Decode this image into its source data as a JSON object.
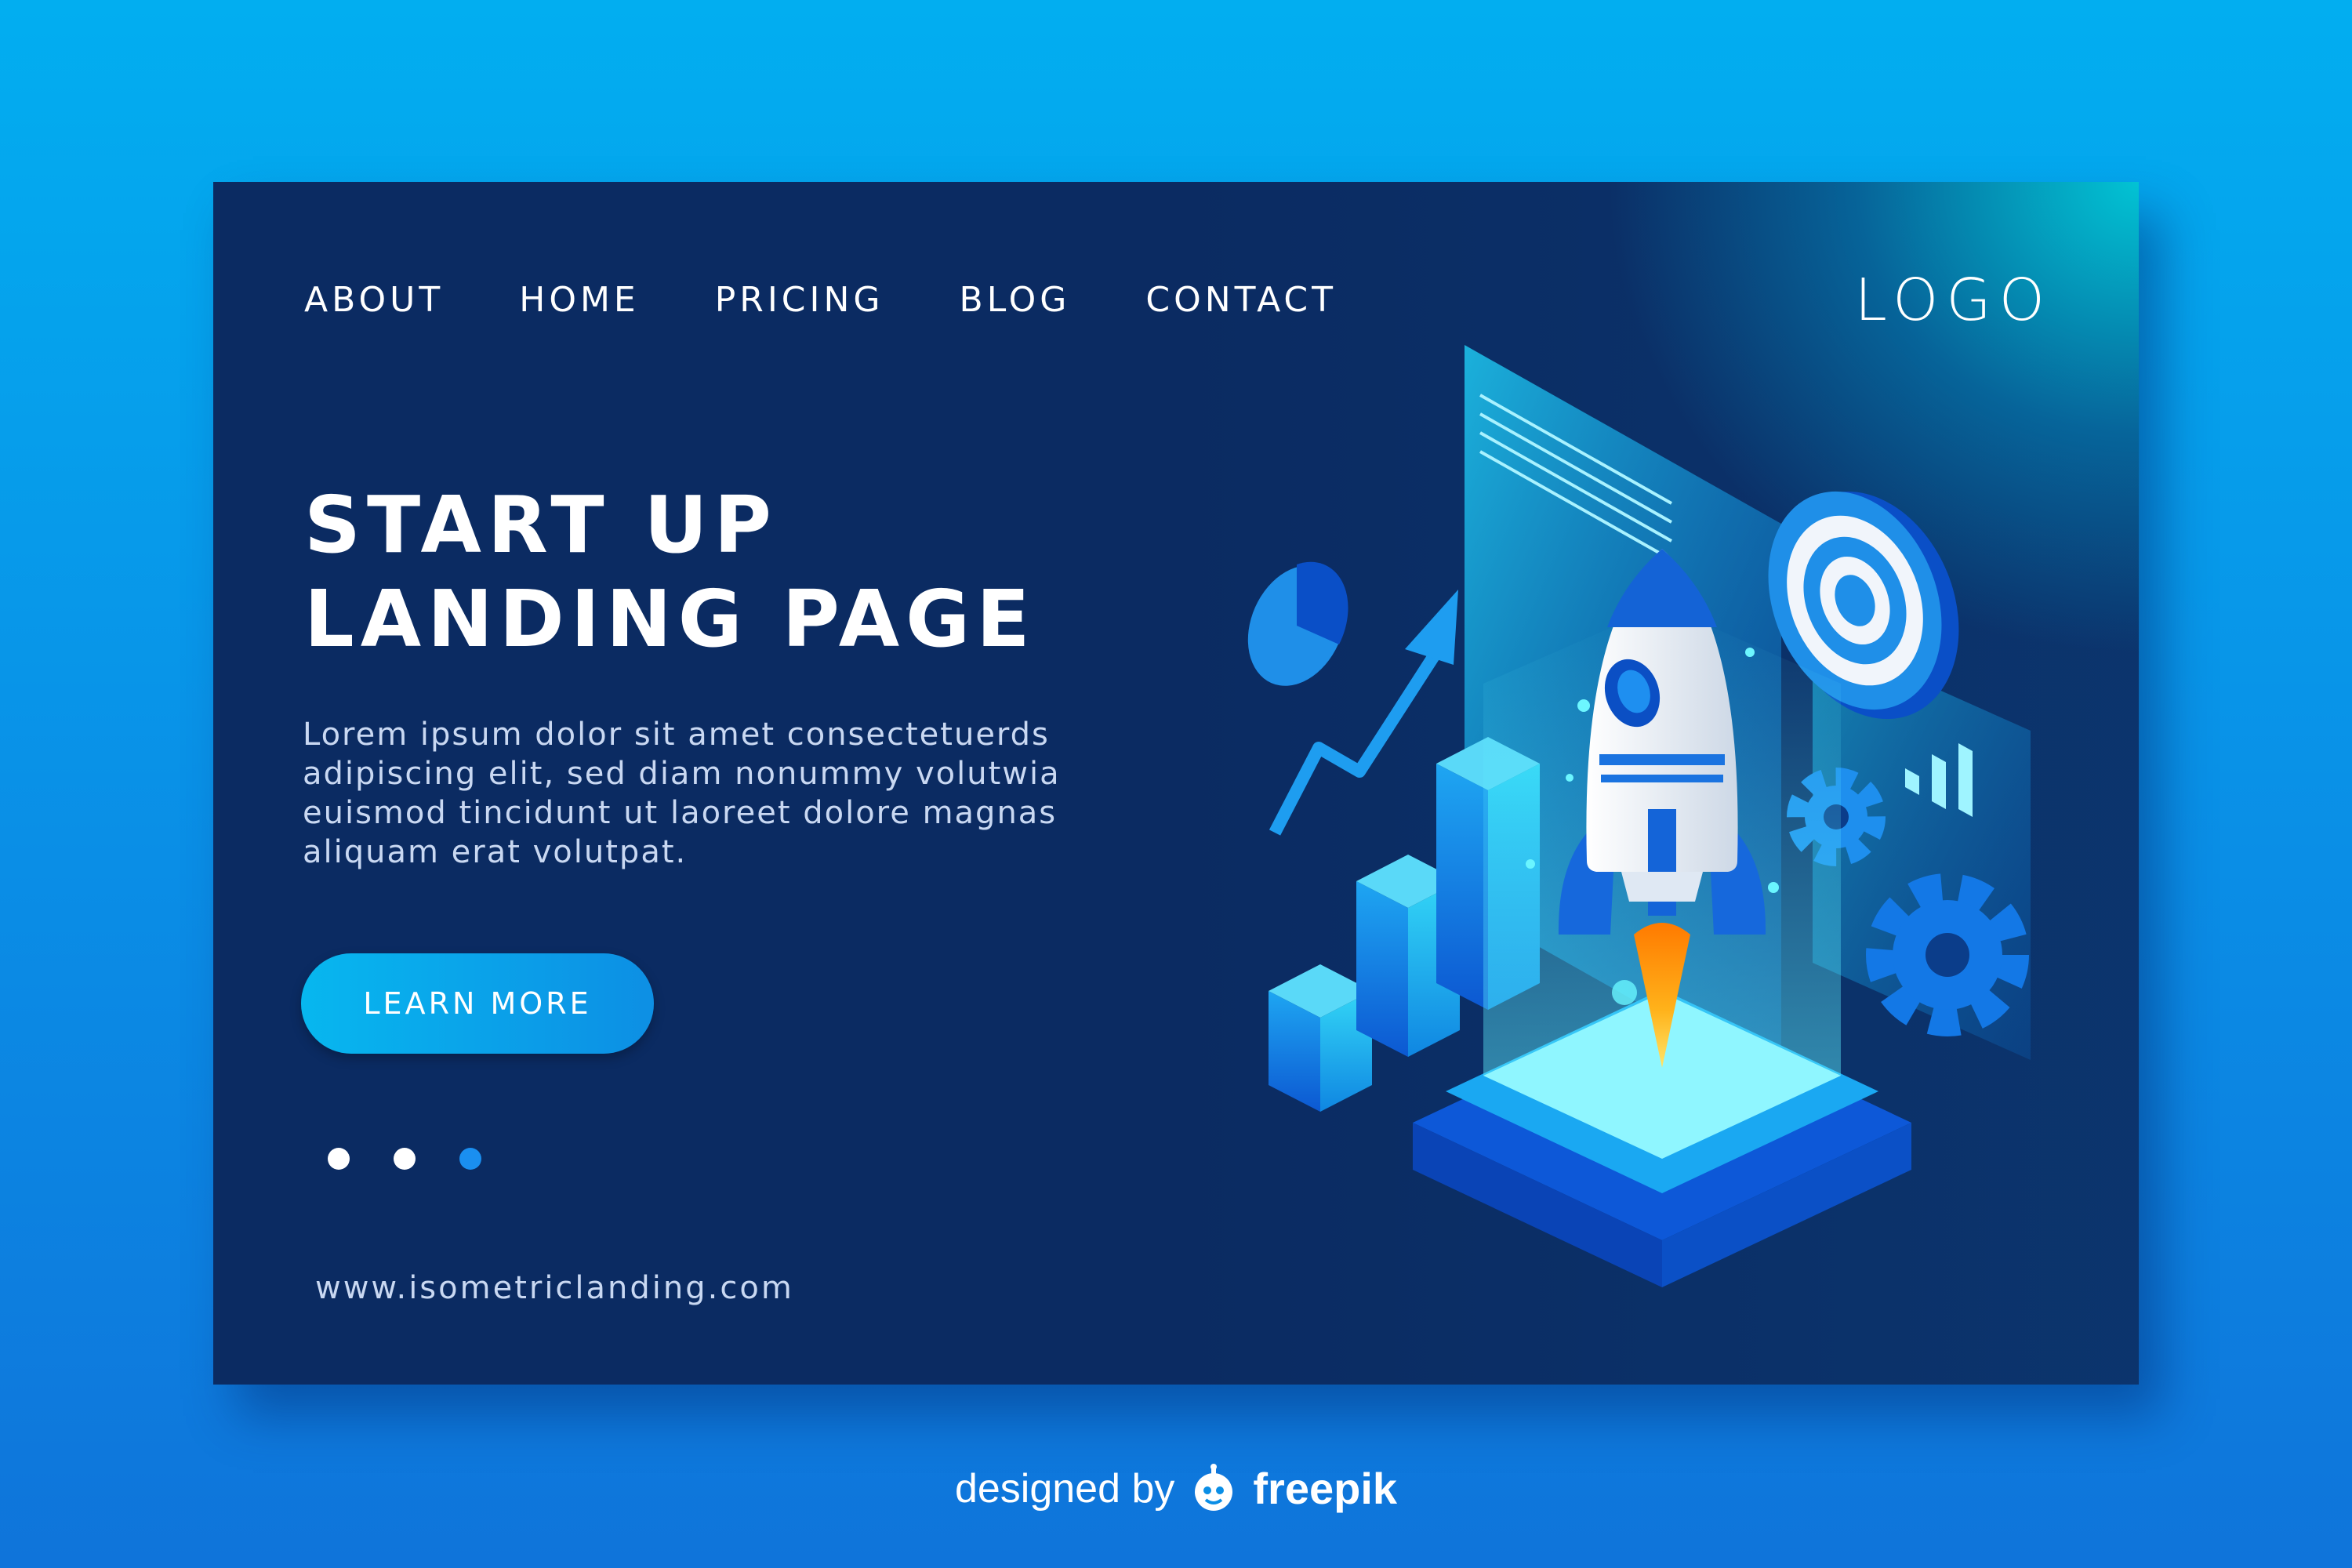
{
  "nav": {
    "items": [
      {
        "label": "ABOUT"
      },
      {
        "label": "HOME"
      },
      {
        "label": "PRICING"
      },
      {
        "label": "BLOG"
      },
      {
        "label": "CONTACT"
      }
    ],
    "logo": "LOGO"
  },
  "hero": {
    "title_lines": [
      "START UP",
      "LANDING PAGE"
    ],
    "text_lines": [
      "Lorem ipsum dolor sit amet consectetuerds",
      "adipiscing elit, sed diam nonummy volutwia",
      "euismod tincidunt ut laoreet dolore magnas",
      "aliquam erat volutpat."
    ],
    "cta_label": "LEARN MORE",
    "slider": {
      "count": 3,
      "active_index": 2
    }
  },
  "footer": {
    "url": "www.isometriclanding.com"
  },
  "credit": {
    "prefix": "designed by",
    "brand": "freepik"
  },
  "colors": {
    "background": "#0a8ee6",
    "card": "#0b2b62",
    "accent": "#07b7ef",
    "glow": "#00dce6",
    "flame": "#ffa21a"
  },
  "icons": [
    "rocket-icon",
    "target-icon",
    "gear-icon",
    "pie-chart-icon",
    "trend-arrow-icon",
    "bar-chart-icon",
    "freepik-mascot-icon"
  ]
}
